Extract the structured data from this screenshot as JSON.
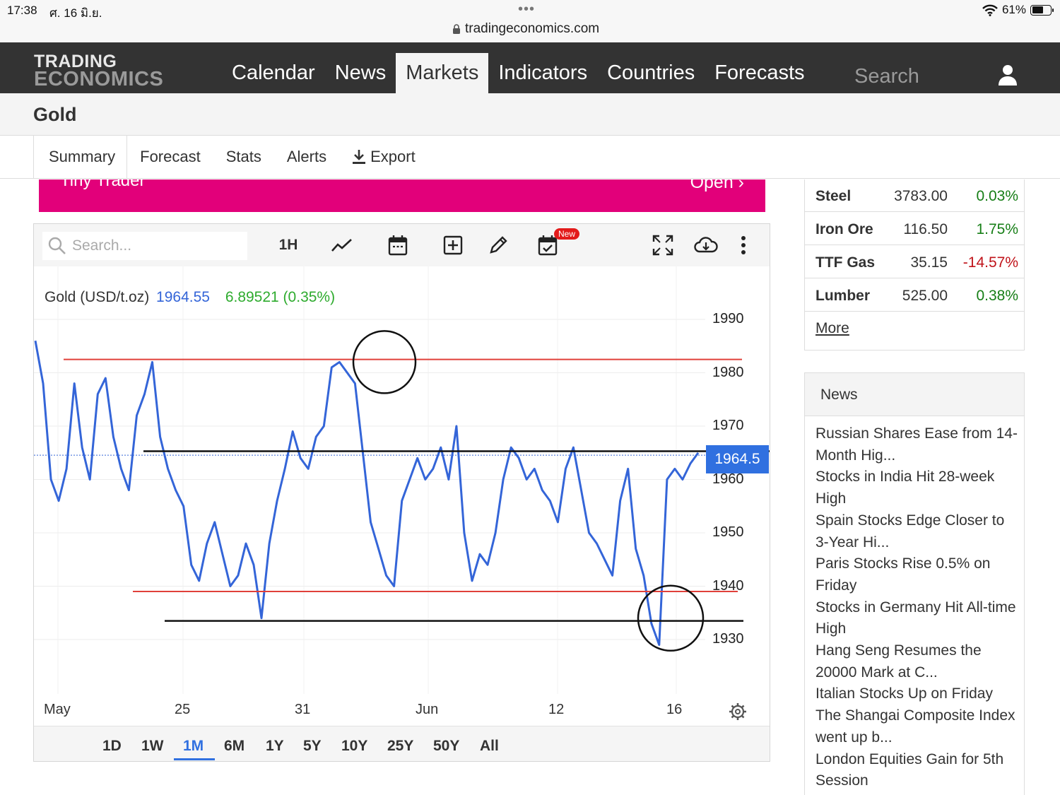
{
  "status_bar": {
    "time": "17:38",
    "date": "ศ. 16 มิ.ย.",
    "url": "tradingeconomics.com",
    "battery": "61%"
  },
  "nav": {
    "logo_line1": "TRADING",
    "logo_line2": "ECONOMICS",
    "items": [
      "Calendar",
      "News",
      "Markets",
      "Indicators",
      "Countries",
      "Forecasts"
    ],
    "active": "Markets",
    "search_placeholder": "Search"
  },
  "page_title": "Gold",
  "subnav": {
    "tabs": [
      "Summary",
      "Forecast",
      "Stats",
      "Alerts"
    ],
    "export_label": "Export",
    "active": "Summary"
  },
  "ad": {
    "left_text": "Tiny Trader",
    "right_text": "Open ›"
  },
  "chart_toolbar": {
    "search_placeholder": "Search...",
    "interval_label": "1H",
    "new_badge": "New"
  },
  "chart_legend": {
    "name": "Gold (USD/t.oz)",
    "price": "1964.55",
    "change": "6.89521 (0.35%)"
  },
  "price_tag": "1964.5",
  "ranges": [
    "1D",
    "1W",
    "1M",
    "6M",
    "1Y",
    "5Y",
    "10Y",
    "25Y",
    "50Y",
    "All"
  ],
  "active_range": "1M",
  "chart_data": {
    "type": "line",
    "series": [
      {
        "name": "Gold (USD/t.oz)",
        "color": "#3465d8",
        "y": [
          1986,
          1978,
          1960,
          1956,
          1962,
          1978,
          1966,
          1960,
          1976,
          1979,
          1968,
          1962,
          1958,
          1972,
          1976,
          1982,
          1968,
          1962,
          1958,
          1955,
          1944,
          1941,
          1948,
          1952,
          1946,
          1940,
          1942,
          1948,
          1944,
          1934,
          1948,
          1956,
          1962,
          1969,
          1964,
          1962,
          1968,
          1970,
          1981,
          1982,
          1980,
          1978,
          1965,
          1952,
          1947,
          1942,
          1940,
          1956,
          1960,
          1964,
          1960,
          1962,
          1966,
          1960,
          1970,
          1950,
          1941,
          1946,
          1944,
          1950,
          1960,
          1966,
          1964,
          1960,
          1962,
          1958,
          1956,
          1952,
          1962,
          1966,
          1958,
          1950,
          1948,
          1945,
          1942,
          1956,
          1962,
          1947,
          1942,
          1933,
          1929,
          1960,
          1962,
          1960,
          1963,
          1965
        ]
      }
    ],
    "x_ticks": [
      "May",
      "25",
      "31",
      "Jun",
      "12",
      "16"
    ],
    "y_ticks": [
      1990,
      1980,
      1970,
      1960,
      1950,
      1940,
      1930
    ],
    "ylim": [
      1920,
      1995
    ],
    "last_value": 1964.55,
    "annotations": {
      "red_lines": [
        1982.5,
        1939
      ],
      "black_lines": [
        1965.3,
        1933.5
      ],
      "circles": [
        1982,
        1934
      ]
    },
    "grid": true
  },
  "markets": [
    {
      "name": "Steel",
      "value": "3783.00",
      "change": "0.03%",
      "dir": "up"
    },
    {
      "name": "Iron Ore",
      "value": "116.50",
      "change": "1.75%",
      "dir": "up"
    },
    {
      "name": "TTF Gas",
      "value": "35.15",
      "change": "-14.57%",
      "dir": "down"
    },
    {
      "name": "Lumber",
      "value": "525.00",
      "change": "0.38%",
      "dir": "up"
    }
  ],
  "markets_more": "More",
  "news": {
    "heading": "News",
    "items": [
      "Russian Shares Ease from 14-Month Hig...",
      "Stocks in India Hit 28-week High",
      "Spain Stocks Edge Closer to 3-Year Hi...",
      "Paris Stocks Rise 0.5% on Friday",
      "Stocks in Germany Hit All-time High",
      "Hang Seng Resumes the 20000 Mark at C...",
      "Italian Stocks Up on Friday",
      "The Shangai Composite Index went up b...",
      "London Equities Gain for 5th Session"
    ]
  }
}
